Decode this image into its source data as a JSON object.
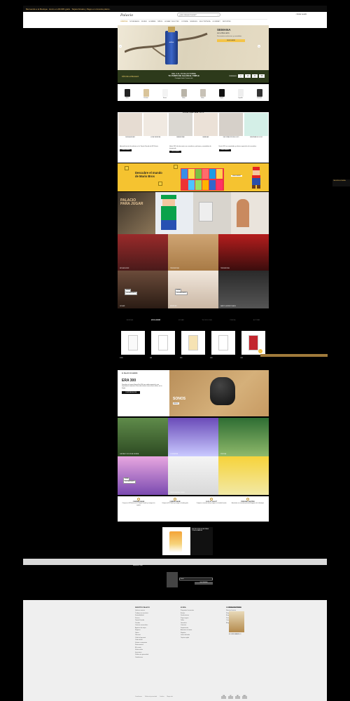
{
  "topbar": {
    "promo_text": "Bienvenido a la Boutique · Envío en 24h/48h gratis · Tarjeta Dorada y Pagos en cómodos plazos ·"
  },
  "util": {
    "items": [
      "ESPECTACULAR RESUMEN",
      "TARJETA DORADA",
      "NUEVA COLECCIÓN",
      "TIENDAS",
      "REGALOS",
      "BODAS",
      "AYUDA"
    ]
  },
  "lang": [
    "ESPAÑOL",
    "ENGLISH",
    "TIENDAS",
    "IDIOMA",
    "ÁREA PRIVADA",
    "AYUDA",
    "REGALO"
  ],
  "brand": {
    "logo": "Palacio"
  },
  "search": {
    "placeholder": "¿Qué deseas buscar?"
  },
  "account": {
    "login": "Iniciar sesión"
  },
  "nav": {
    "items": [
      "OFERTAS",
      "NOVEDADES",
      "MUJER",
      "HOMBRE",
      "NIÑOS",
      "HOGAR Y ELECTRO",
      "JOYERÍA",
      "MUEBLES",
      "ELECTRÓNICA",
      "GOURMET",
      "DEPORTES"
    ],
    "active_index": 0
  },
  "hero": {
    "bottle_label": "AVÈNE",
    "title": "SEMANA",
    "subtitle": "de la BELLEZA",
    "desc": "Descuentos exclusivos y novedades",
    "button": "DESCUBRIR"
  },
  "strip": {
    "left": "DÍAS DE LA BELLEZA",
    "middle_1": "DEL 3 AL 15 DE OCTUBRE",
    "middle_2": "TU PUNTO DE SALÓN EL TRIPLE",
    "middle_3": "Consigue hasta 3 veces más",
    "countdown_label": "TERMINA EN",
    "countdown": [
      {
        "n": "2",
        "u": "DÍAS"
      },
      {
        "n": "10",
        "u": "HORAS"
      },
      {
        "n": "23",
        "u": "MIN"
      },
      {
        "n": "58",
        "u": "SEG"
      }
    ]
  },
  "products": [
    {
      "name": "Gafas"
    },
    {
      "name": "Perfume"
    },
    {
      "name": "Sérum"
    },
    {
      "name": "Bolso"
    },
    {
      "name": "Bolso"
    },
    {
      "name": "Zapato"
    },
    {
      "name": "Zapatilla"
    },
    {
      "name": "Camiseta"
    }
  ],
  "sec2": {
    "heading": "NUEVAS IDEAS PARA TODOS",
    "categories": [
      "MODA MUJER",
      "LUXE INFINITA",
      "BIENESTAR",
      "BEBIDAS",
      "DECORACIÓN DE LUJO",
      "OFERTAS DE OCIO"
    ],
    "promos": [
      {
        "text": "Aprovéchate de las ofertas en la Tarjeta Dorada de El Palacio",
        "button": "DESCUBRIR"
      },
      {
        "text": "Hasta 30% de descuento en cosméticos, perfumes y novedades de temporada",
        "button": "DESCUBRIR"
      },
      {
        "text": "Hasta 30% en novedades y ofertas especiales de cosmética",
        "button": "DESCUBRIR"
      }
    ]
  },
  "mario": {
    "title_1": "Descubre el mundo",
    "title_2": "de Mario Bros",
    "button": "DESCUBRIR"
  },
  "side_tab": {
    "text": "TARJETA DORADA"
  },
  "palacio": {
    "title_1": "PALACIO",
    "title_2": "PARA JUGAR"
  },
  "fashion": [
    "MODA MUJER",
    "TENDENCIAS",
    "TENDENCIAS"
  ],
  "bags": [
    {
      "tag_1": "NUEVA",
      "tag_2": "-20% DESCUENTO",
      "caption": "HOGAR"
    },
    {
      "tag_1": "NUEVA",
      "tag_2": "-20% DESCUENTO",
      "caption": "MUEBLES"
    },
    {
      "tag_1": "",
      "tag_2": "",
      "caption": "SAINT LAURENT BAGS"
    }
  ],
  "tabs": [
    "BEBIDAS",
    "MODA BEBÉ",
    "HOGAR",
    "TECNOLOGÍA",
    "TIENDA",
    "ACTIVAR"
  ],
  "tabs_active": 1,
  "carousel": [
    {
      "price": "1.999"
    },
    {
      "price": "149"
    },
    {
      "price": "299"
    },
    {
      "price": "149"
    },
    {
      "price": "149"
    }
  ],
  "sec5": {
    "eyebrow": "EL PALACIO DE MADRID",
    "title": "ERA 300",
    "desc": "Descubre el nuevo Sonos Era 300 con audio espacial y una experiencia inmersiva. Escucha música como nunca antes, en tu hogar.",
    "button": "COMPRAR AHORA",
    "speaker_text": "SONOS",
    "speaker_small": "ERA 300"
  },
  "grid6": [
    {
      "caption": "CALZADO DOLCE ALLEGRIA"
    },
    {
      "caption": "CONVERSE"
    },
    {
      "caption": "PISCINA"
    },
    {
      "caption": ""
    },
    {
      "caption": "PERFUMERÍA LOEWE"
    },
    {
      "caption": ""
    }
  ],
  "services": [
    {
      "title": "COMPRAR ONLINE",
      "text": "Compra en El Palacio con tu Tarjeta Dorada y consigue tus regalos"
    },
    {
      "title": "COMPRA ONLINE",
      "text": "Compra en El Palacio y recoge en tienda gratis"
    },
    {
      "title": "CLICK & COLLECT",
      "text": "Compra en nuestra web y recoge en tu tienda favorita"
    },
    {
      "title": "PERSONAL SHOPPER",
      "text": "Asesórate con nuestros personal shoppers de la boutique"
    }
  ],
  "sun": {
    "side_text": "PROTECCIÓN SOLAR PARA TODA LA FAMILIA"
  },
  "newsletter": {
    "title": "NEWSLETTER",
    "input_placeholder": "Email",
    "button": "SUSCRIBIRME"
  },
  "footer": {
    "cols": [
      {
        "heading": "NUESTRO PALACIO",
        "items": [
          "Quiénes somos",
          "Trabaja con nosotros",
          "Sostenibilidad",
          "Prensa",
          "Tarjeta Dorada",
          "Tiendas",
          "Centros comerciales",
          "Agencia de viajes",
          "Seguros",
          "Óptica",
          "Gourmet",
          "Club del gourmet",
          "Club infantil",
          "Ventas a empresas",
          "Restaurantes",
          "Mi cuenta",
          "Venta online",
          "Inversores",
          "Política de privacidad",
          "Condiciones"
        ]
      },
      {
        "heading": "AYUDA",
        "items": [
          "Preguntas frecuentes",
          "Envíos",
          "Devoluciones",
          "Pago seguro",
          "Tallas",
          "Garantías",
          "Contacto",
          "Seguimiento",
          "Atención al cliente",
          "Regalos",
          "Listas de boda",
          "Tarjeta regalo"
        ]
      },
      {
        "heading": "SOBRE NOSOTROS",
        "items": [
          "Nuestra historia",
          "Responsabilidad",
          "Empleo",
          "Proveedores",
          "Canal ético",
          "Blog"
        ]
      }
    ],
    "publications_heading": "PUBLICACIONES",
    "publication_caption": "EL LIBRO AMARILLO",
    "legal": [
      "Condiciones",
      "Política de privacidad",
      "Cookies",
      "Mapa web"
    ],
    "payments": [
      "VISA",
      "MC",
      "PAY",
      "AMEX"
    ]
  }
}
